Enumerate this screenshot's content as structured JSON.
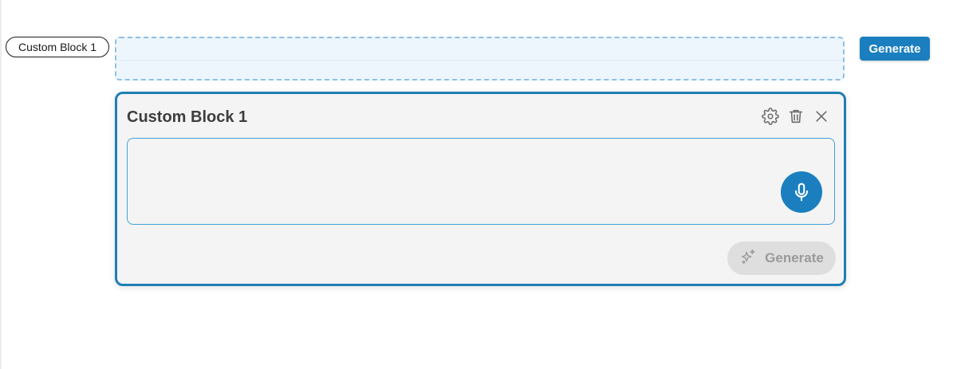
{
  "block_tag": {
    "label": "Custom Block 1"
  },
  "toolbar": {
    "generate_label": "Generate"
  },
  "card": {
    "title": "Custom Block 1",
    "input_value": "",
    "icons": {
      "settings": "gear-icon",
      "delete": "trash-icon",
      "close": "close-icon",
      "mic": "microphone-icon",
      "sparkle": "sparkles-icon"
    },
    "generate_label": "Generate"
  },
  "colors": {
    "accent": "#1b7fbf",
    "card_border": "#1f7eb5",
    "dropzone_bg": "#eef6fd",
    "disabled_bg": "#dedede"
  }
}
